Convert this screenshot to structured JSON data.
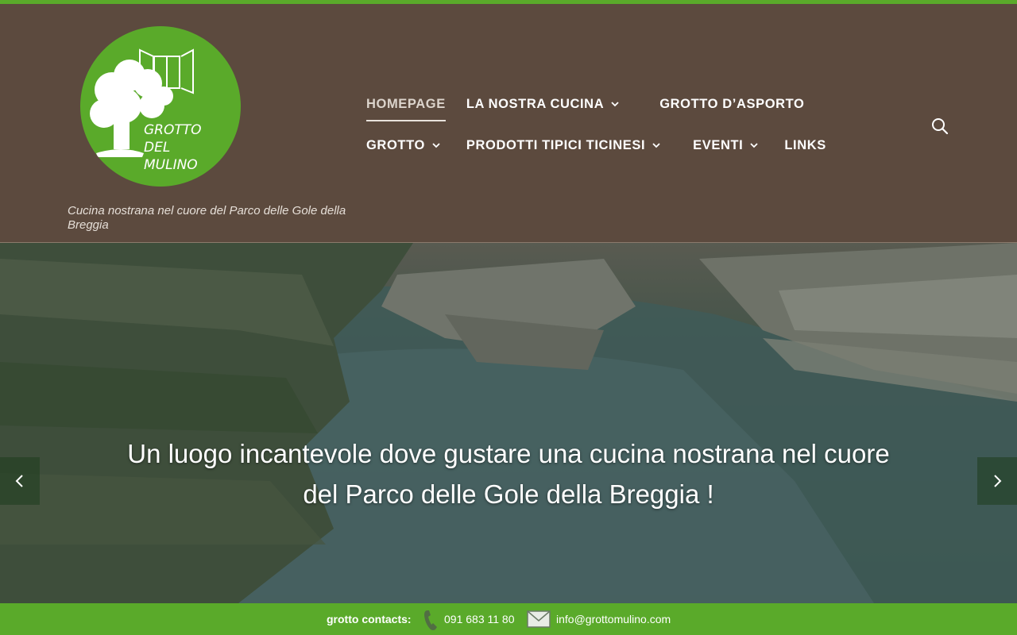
{
  "site": {
    "logo_text_lines": [
      "GROTTO",
      "DEL",
      "MULINO"
    ],
    "tagline": "Cucina nostrana nel cuore del Parco delle Gole della Breggia"
  },
  "nav": {
    "row1": [
      {
        "label": "HOMEPAGE",
        "active": true,
        "dropdown": false
      },
      {
        "label": "LA NOSTRA CUCINA",
        "active": false,
        "dropdown": true
      },
      {
        "label": "GROTTO D’ASPORTO",
        "active": false,
        "dropdown": false
      }
    ],
    "row2": [
      {
        "label": "GROTTO",
        "active": false,
        "dropdown": true
      },
      {
        "label": "PRODOTTI TIPICI TICINESI",
        "active": false,
        "dropdown": true
      },
      {
        "label": "EVENTI",
        "active": false,
        "dropdown": true
      },
      {
        "label": "LINKS",
        "active": false,
        "dropdown": false
      }
    ],
    "search_icon": "search-icon"
  },
  "hero": {
    "caption_line1": "Un luogo incantevole dove gustare una cucina nostrana nel cuore",
    "caption_line2": "del Parco delle Gole della Breggia !",
    "prev_icon": "chevron-left-icon",
    "next_icon": "chevron-right-icon"
  },
  "footer": {
    "label": "grotto contacts:",
    "phone": "091 683 11 80",
    "email": "info@grottomulino.com"
  },
  "colors": {
    "brand_green": "#5aaa2a",
    "header_brown": "#5c4a3e"
  }
}
